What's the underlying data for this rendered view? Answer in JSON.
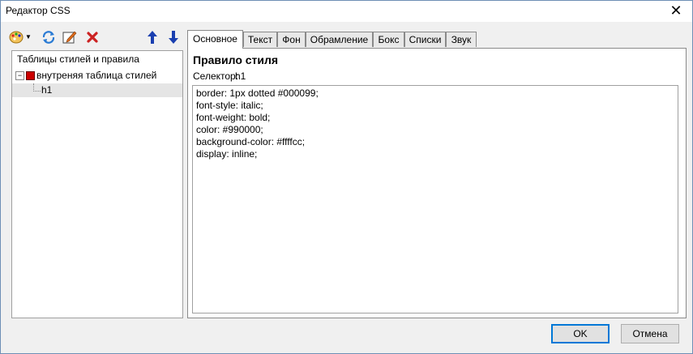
{
  "window": {
    "title": "Редактор CSS"
  },
  "toolbar": {
    "icons": [
      "palette-icon",
      "refresh-icon",
      "edit-icon",
      "delete-icon",
      "move-up-icon",
      "move-down-icon"
    ]
  },
  "tree": {
    "header": "Таблицы стилей и правила",
    "node_label": "внутреняя таблица стилей",
    "leaf_label": "h1"
  },
  "tabs": [
    "Основное",
    "Текст",
    "Фон",
    "Обрамление",
    "Бокс",
    "Списки",
    "Звук"
  ],
  "panel": {
    "rule_title": "Правило стиля",
    "selector_label": "Селектор:",
    "selector_value": "h1",
    "css_lines": [
      "border: 1px dotted #000099;",
      "font-style: italic;",
      "font-weight: bold;",
      "color: #990000;",
      "background-color: #ffffcc;",
      "display: inline;"
    ]
  },
  "buttons": {
    "ok": "OK",
    "cancel": "Отмена"
  },
  "colors": {
    "accent": "#0078d7",
    "delete": "#cc2222",
    "arrows": "#1a3fb0"
  }
}
